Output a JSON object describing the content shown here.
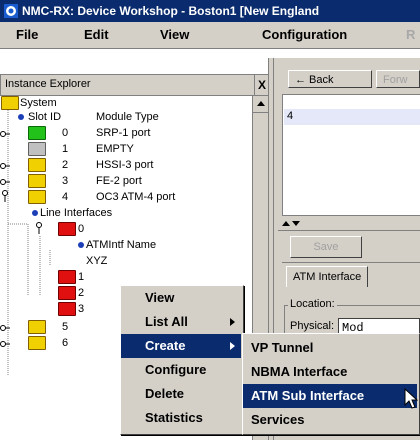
{
  "window": {
    "title": "NMC-RX: Device Workshop - Boston1 [New England"
  },
  "menubar": {
    "items": [
      {
        "label": "File",
        "dim": false
      },
      {
        "label": "Edit",
        "dim": false
      },
      {
        "label": "View",
        "dim": false
      },
      {
        "label": "Configuration",
        "dim": false
      },
      {
        "label": "R",
        "dim": true
      }
    ]
  },
  "left_pane": {
    "title": "Instance Explorer",
    "close": "X"
  },
  "tree": {
    "system": "System",
    "slot_id_header": "Slot ID",
    "module_type_header": "Module Type",
    "slots": [
      {
        "id": "0",
        "type": "SRP-1 port"
      },
      {
        "id": "1",
        "type": "EMPTY"
      },
      {
        "id": "2",
        "type": "HSSI-3 port"
      },
      {
        "id": "3",
        "type": "FE-2 port"
      },
      {
        "id": "4",
        "type": "OC3 ATM-4 port"
      }
    ],
    "line_interfaces": "Line Interfaces",
    "li_0": "0",
    "atm_intf_name": "ATMIntf Name",
    "xyz": "XYZ",
    "li_1": "1",
    "li_2": "2",
    "li_3": "3",
    "slot_5": "5",
    "slot_6": "6"
  },
  "right_pane": {
    "back": "← Back",
    "forward": "Forw",
    "list_value": "4",
    "save": "Save",
    "tab_label": "ATM Interface",
    "location_label": "Location:",
    "physical_label": "Physical:",
    "physical_value": "Mod"
  },
  "context_menu": {
    "items": [
      "View",
      "List All",
      "Create",
      "Configure",
      "Delete",
      "Statistics"
    ]
  },
  "create_submenu": {
    "items": [
      "VP Tunnel",
      "NBMA Interface",
      "ATM Sub Interface",
      "Services"
    ]
  },
  "colors": {
    "titlebar": "#0a2c6e",
    "folder_yellow": "#f0d000",
    "folder_green": "#22c21a",
    "folder_red": "#e01010",
    "highlight": "#0a2c6e"
  }
}
